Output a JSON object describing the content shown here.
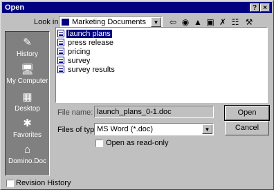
{
  "window": {
    "title": "Open"
  },
  "titlebar_buttons": {
    "help": "?",
    "close": "×"
  },
  "lookin": {
    "label": "Look in:",
    "value": "Marketing Documents"
  },
  "toolbar": [
    {
      "name": "back-icon",
      "glyph": "⇦"
    },
    {
      "name": "search-web-icon",
      "glyph": "◉"
    },
    {
      "name": "up-folder-icon",
      "glyph": "▲"
    },
    {
      "name": "new-folder-icon",
      "glyph": "▣"
    },
    {
      "name": "delete-icon",
      "glyph": "✗"
    },
    {
      "name": "views-icon",
      "glyph": "☷"
    },
    {
      "name": "tools-icon",
      "glyph": "⚒"
    }
  ],
  "places": [
    {
      "label": "History",
      "icon": "history-icon",
      "glyph": "✎"
    },
    {
      "label": "My Computer",
      "icon": "my-computer-icon",
      "glyph": "🖥"
    },
    {
      "label": "Desktop",
      "icon": "desktop-icon",
      "glyph": "▦"
    },
    {
      "label": "Favorites",
      "icon": "favorites-icon",
      "glyph": "✱"
    },
    {
      "label": "Domino.Doc",
      "icon": "domino-doc-icon",
      "glyph": "⌂"
    }
  ],
  "files": [
    "launch plans",
    "press release",
    "pricing",
    "survey",
    "survey results"
  ],
  "selected_index": 0,
  "filename": {
    "label": "File name:",
    "value": "launch_plans_0-1.doc"
  },
  "filetype": {
    "label": "Files of type:",
    "value": "MS Word (*.doc)"
  },
  "readonly": {
    "label": "Open as read-only",
    "checked": false
  },
  "buttons": {
    "open": "Open",
    "cancel": "Cancel"
  },
  "revision": {
    "label": "Revision History",
    "checked": false
  }
}
